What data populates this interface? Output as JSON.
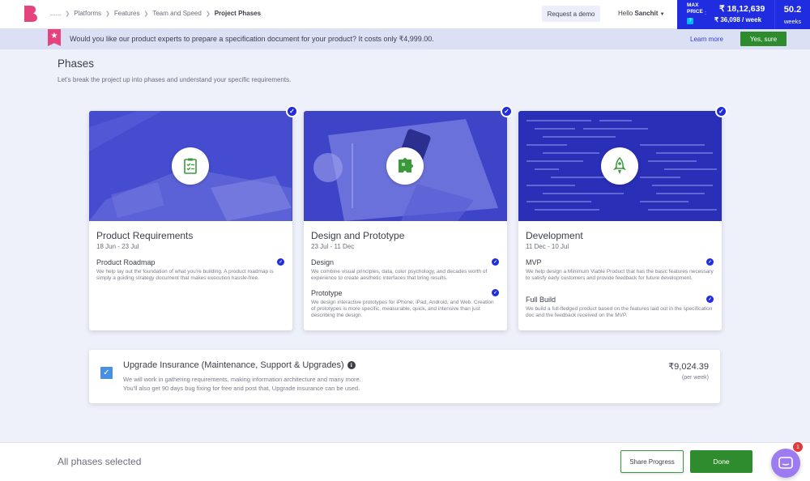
{
  "header": {
    "breadcrumb": [
      "......",
      "Platforms",
      "Features",
      "Team and Speed",
      "Project Phases"
    ],
    "demo_label": "Request a demo",
    "greeting": "Hello",
    "user_name": "Sanchit",
    "max_price_label": "MAX PRICE",
    "help_label": "?",
    "colon": ":",
    "max_price": "₹ 18,12,639",
    "price_per_week": "₹ 36,098 / week",
    "weeks_value": "50.2",
    "weeks_label": "weeks"
  },
  "promo": {
    "text": "Would you like our product experts to prepare a specification document for your product? It costs only ₹4,999.00.",
    "learn_more": "Learn more",
    "accept_label": "Yes, sure"
  },
  "main": {
    "title": "Phases",
    "subtitle": "Let's break the project up into phases and understand your specific requirements."
  },
  "phases": [
    {
      "title": "Product Requirements",
      "dates": "18 Jun - 23 Jul",
      "icon": "checklist-icon",
      "features": [
        {
          "name": "Product Roadmap",
          "desc": "We help lay out the foundation of what you're building. A product roadmap is simply a guiding strategy document that makes execution hassle-free."
        }
      ]
    },
    {
      "title": "Design and Prototype",
      "dates": "23 Jul - 11 Dec",
      "icon": "puzzle-icon",
      "features": [
        {
          "name": "Design",
          "desc": "We combine visual principles, data, color psychology, and decades worth of experience to create aesthetic interfaces that bring results."
        },
        {
          "name": "Prototype",
          "desc": "We design interactive prototypes for iPhone, iPad, Android, and Web. Creation of prototypes is more specific, measurable, quick, and intensive than just describing the design."
        }
      ]
    },
    {
      "title": "Development",
      "dates": "11 Dec - 10 Jul",
      "icon": "rocket-icon",
      "features": [
        {
          "name": "MVP",
          "desc": "We help design a Minimum Viable Product that has the basic features necessary to satisfy early customers and provide feedback for future development."
        },
        {
          "name": "Full Build",
          "desc": "We build a full-fledged product based on the features laid out in the specification doc and the feedback received on the MVP."
        }
      ]
    }
  ],
  "insurance": {
    "title": "Upgrade Insurance (Maintenance, Support & Upgrades)",
    "info_label": "i",
    "desc_line1": "We will work in gathering requirements, making information architecture and many more.",
    "desc_line2": "You'll also get 90 days bug fixing for free and post that, Upgrade insurance can be used.",
    "price": "₹9,024.39",
    "per": "(per week)",
    "checked": true
  },
  "footer": {
    "status": "All phases selected",
    "share_label": "Share Progress",
    "done_label": "Done",
    "chat_badge": "1"
  },
  "colors": {
    "accent": "#1f2ce0",
    "overlay": "#3d44c8",
    "success": "#2e8b2e",
    "promo_bg": "#dbe0f5",
    "brand": "#e5437e",
    "chat": "#9c7cf0"
  }
}
